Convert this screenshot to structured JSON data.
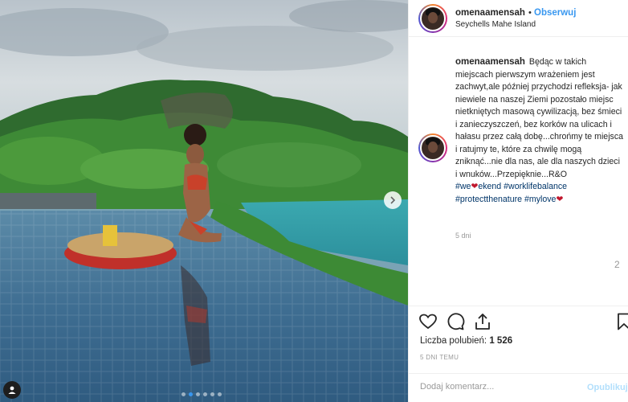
{
  "photo": {
    "alt_icon": "user-tag-icon",
    "next_icon": "chevron-right-icon",
    "carousel": {
      "count": 6,
      "active": 1
    }
  },
  "header": {
    "username": "omenaamensah",
    "separator": "•",
    "follow_label": "Obserwuj",
    "location": "Seychells Mahe Island"
  },
  "caption": {
    "username": "omenaamensah",
    "text": "Będąc w takich miejscach pierwszym wrażeniem jest zachwyt,ale później przychodzi refleksja- jak niewiele na naszej Ziemi pozostało miejsc nietkniętych masową cywilizacją, bez śmieci i zanieczyszczeń, bez korków na ulicach i hałasu przez całą dobę...chrońmy te miejsca i ratujmy te, które za chwilę mogą zniknąć...nie dla nas, ale dla naszych dzieci i wnuków...Przepięknie...R&O",
    "tag1_a": "#we",
    "tag1_heart": "❤",
    "tag1_b": "ekend",
    "tag2": "#worklifebalance",
    "tag3": "#protectthenature",
    "tag4": "#mylove",
    "tag4_heart": "❤",
    "time": "5 dni",
    "side_num": "2"
  },
  "actions": {
    "like_icon": "heart-icon",
    "comment_icon": "comment-icon",
    "share_icon": "share-icon",
    "save_icon": "bookmark-icon"
  },
  "likes": {
    "label": "Liczba polubień:",
    "count": "1 526"
  },
  "date": "5 DNI TEMU",
  "comment_box": {
    "placeholder": "Dodaj komentarz...",
    "publish_label": "Opublikuj"
  },
  "colors": {
    "link": "#3897f0",
    "hashtag": "#003569",
    "muted": "#999999",
    "publish_disabled": "#b2dffc"
  }
}
